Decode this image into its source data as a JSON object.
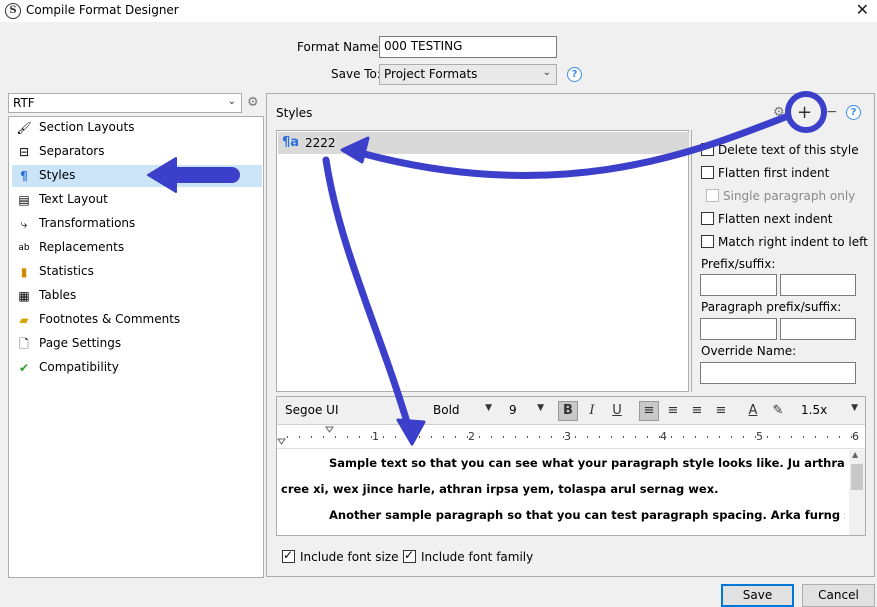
{
  "window": {
    "title": "Compile Format Designer",
    "app_icon_letter": "S"
  },
  "header": {
    "format_name_label": "Format Name:",
    "format_name_value": "000 TESTING",
    "save_to_label": "Save To:",
    "save_to_value": "Project Formats"
  },
  "sidebar": {
    "format_select": "RTF",
    "items": [
      {
        "label": "Section Layouts",
        "icon": "brush-icon"
      },
      {
        "label": "Separators",
        "icon": "separator-icon"
      },
      {
        "label": "Styles",
        "icon": "paragraph-style-icon",
        "selected": true
      },
      {
        "label": "Text Layout",
        "icon": "text-layout-icon"
      },
      {
        "label": "Transformations",
        "icon": "transformations-icon"
      },
      {
        "label": "Replacements",
        "icon": "replacements-icon"
      },
      {
        "label": "Statistics",
        "icon": "bar-chart-icon"
      },
      {
        "label": "Tables",
        "icon": "table-icon"
      },
      {
        "label": "Footnotes & Comments",
        "icon": "note-icon"
      },
      {
        "label": "Page Settings",
        "icon": "page-icon"
      },
      {
        "label": "Compatibility",
        "icon": "compatibility-icon"
      }
    ]
  },
  "styles_panel": {
    "heading": "Styles",
    "list": [
      {
        "name": "2222",
        "icon": "paragraph-style-icon",
        "selected": true
      }
    ],
    "options": {
      "delete_text": "Delete text of this style",
      "flatten_first": "Flatten first indent",
      "single_paragraph": "Single paragraph only",
      "flatten_next": "Flatten next indent",
      "match_right": "Match right indent to left",
      "prefix_suffix_label": "Prefix/suffix:",
      "paragraph_prefix_suffix_label": "Paragraph prefix/suffix:",
      "override_name_label": "Override Name:"
    }
  },
  "editor": {
    "font_family": "Segoe UI",
    "font_weight": "Bold",
    "font_size": "9",
    "line_spacing": "1.5x",
    "ruler_numbers": [
      "1",
      "2",
      "3",
      "4",
      "5",
      "6"
    ],
    "sample_paragraphs": [
      "Sample text so that you can see what your paragraph style looks like. Ju arthran morvit fli",
      "cree xi, wex jince harle, athran irpsa yem, tolaspa arul sernag wex.",
      "Another sample paragraph so that you can test paragraph spacing. Arka furng su harle arka su"
    ],
    "include_font_size": "Include font size",
    "include_font_family": "Include font family"
  },
  "footer": {
    "save_label": "Save",
    "cancel_label": "Cancel"
  },
  "annotation_color": "#3b3fc9"
}
